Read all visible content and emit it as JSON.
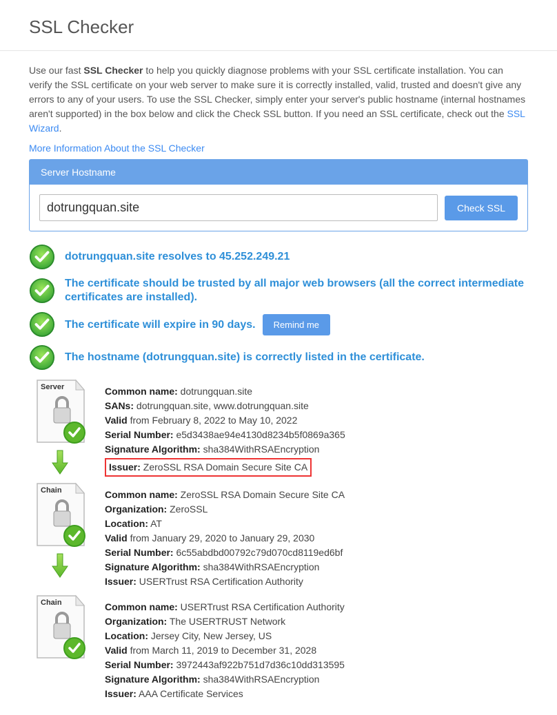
{
  "page": {
    "title": "SSL Checker"
  },
  "intro": {
    "pre": "Use our fast ",
    "bold": "SSL Checker",
    "post": " to help you quickly diagnose problems with your SSL certificate installation. You can verify the SSL certificate on your web server to make sure it is correctly installed, valid, trusted and doesn't give any errors to any of your users. To use the SSL Checker, simply enter your server's public hostname (internal hostnames aren't supported) in the box below and click the Check SSL button. If you need an SSL certificate, check out the ",
    "wizard_link": "SSL Wizard",
    "period": "."
  },
  "more_info": "More Information About the SSL Checker",
  "form": {
    "panel_title": "Server Hostname",
    "hostname": "dotrungquan.site",
    "check_label": "Check SSL"
  },
  "checks": [
    {
      "text": "dotrungquan.site resolves to 45.252.249.21"
    },
    {
      "text": "The certificate should be trusted by all major web browsers (all the correct intermediate certificates are installed)."
    },
    {
      "text": "The certificate will expire in 90 days.",
      "remind": "Remind me"
    },
    {
      "text": "The hostname (dotrungquan.site) is correctly listed in the certificate."
    }
  ],
  "certs": [
    {
      "tag": "Server",
      "common_name_label": "Common name:",
      "common_name": " dotrungquan.site",
      "sans_label": "SANs:",
      "sans": " dotrungquan.site, www.dotrungquan.site",
      "valid_label": "Valid",
      "valid": " from February 8, 2022 to May 10, 2022",
      "serial_label": "Serial Number:",
      "serial": " e5d3438ae94e4130d8234b5f0869a365",
      "sigalg_label": "Signature Algorithm:",
      "sigalg": " sha384WithRSAEncryption",
      "issuer_label": "Issuer:",
      "issuer": " ZeroSSL RSA Domain Secure Site CA",
      "highlight_issuer": true,
      "has_arrow": true
    },
    {
      "tag": "Chain",
      "common_name_label": "Common name:",
      "common_name": " ZeroSSL RSA Domain Secure Site CA",
      "org_label": "Organization:",
      "org": " ZeroSSL",
      "loc_label": "Location:",
      "loc": " AT",
      "valid_label": "Valid",
      "valid": " from January 29, 2020 to January 29, 2030",
      "serial_label": "Serial Number:",
      "serial": " 6c55abdbd00792c79d070cd8119ed6bf",
      "sigalg_label": "Signature Algorithm:",
      "sigalg": " sha384WithRSAEncryption",
      "issuer_label": "Issuer:",
      "issuer": " USERTrust RSA Certification Authority",
      "has_arrow": true
    },
    {
      "tag": "Chain",
      "common_name_label": "Common name:",
      "common_name": " USERTrust RSA Certification Authority",
      "org_label": "Organization:",
      "org": " The USERTRUST Network",
      "loc_label": "Location:",
      "loc": " Jersey City, New Jersey, US",
      "valid_label": "Valid",
      "valid": " from March 11, 2019 to December 31, 2028",
      "serial_label": "Serial Number:",
      "serial": " 3972443af922b751d7d36c10dd313595",
      "sigalg_label": "Signature Algorithm:",
      "sigalg": " sha384WithRSAEncryption",
      "issuer_label": "Issuer:",
      "issuer": " AAA Certificate Services",
      "has_arrow": false
    }
  ]
}
